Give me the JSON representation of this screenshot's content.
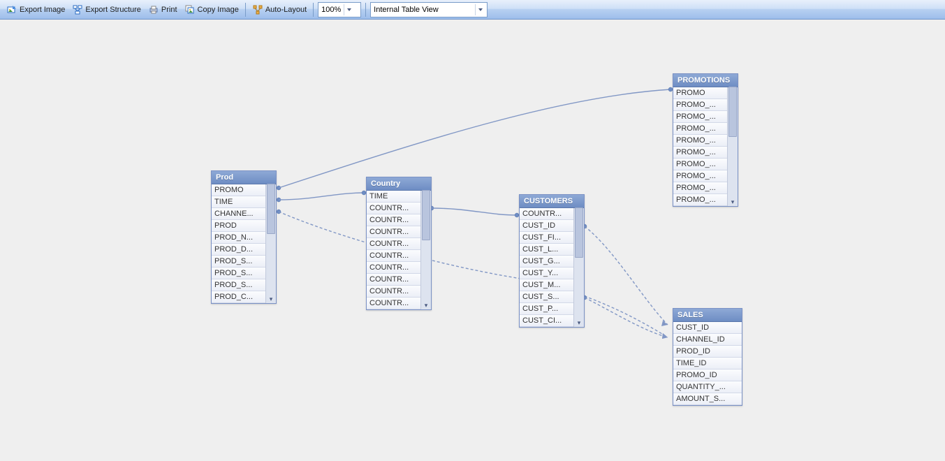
{
  "toolbar": {
    "export_image": "Export Image",
    "export_structure": "Export Structure",
    "print": "Print",
    "copy_image": "Copy Image",
    "auto_layout": "Auto-Layout",
    "zoom": "100%",
    "view_mode": "Internal Table View"
  },
  "nodes": {
    "prod": {
      "title": "Prod",
      "rows": [
        "PROMO",
        "TIME",
        "CHANNE...",
        "PROD",
        "PROD_N...",
        "PROD_D...",
        "PROD_S...",
        "PROD_S...",
        "PROD_S...",
        "PROD_C..."
      ]
    },
    "country": {
      "title": "Country",
      "rows": [
        "TIME",
        "COUNTR...",
        "COUNTR...",
        "COUNTR...",
        "COUNTR...",
        "COUNTR...",
        "COUNTR...",
        "COUNTR...",
        "COUNTR...",
        "COUNTR..."
      ]
    },
    "customers": {
      "title": "CUSTOMERS",
      "rows": [
        "COUNTR...",
        "CUST_ID",
        "CUST_FI...",
        "CUST_L...",
        "CUST_G...",
        "CUST_Y...",
        "CUST_M...",
        "CUST_S...",
        "CUST_P...",
        "CUST_CI..."
      ]
    },
    "promotions": {
      "title": "PROMOTIONS",
      "rows": [
        "PROMO",
        "PROMO_...",
        "PROMO_...",
        "PROMO_...",
        "PROMO_...",
        "PROMO_...",
        "PROMO_...",
        "PROMO_...",
        "PROMO_...",
        "PROMO_..."
      ]
    },
    "sales": {
      "title": "SALES",
      "rows": [
        "CUST_ID",
        "CHANNEL_ID",
        "PROD_ID",
        "TIME_ID",
        "PROMO_ID",
        "QUANTITY_...",
        "AMOUNT_S..."
      ]
    }
  }
}
